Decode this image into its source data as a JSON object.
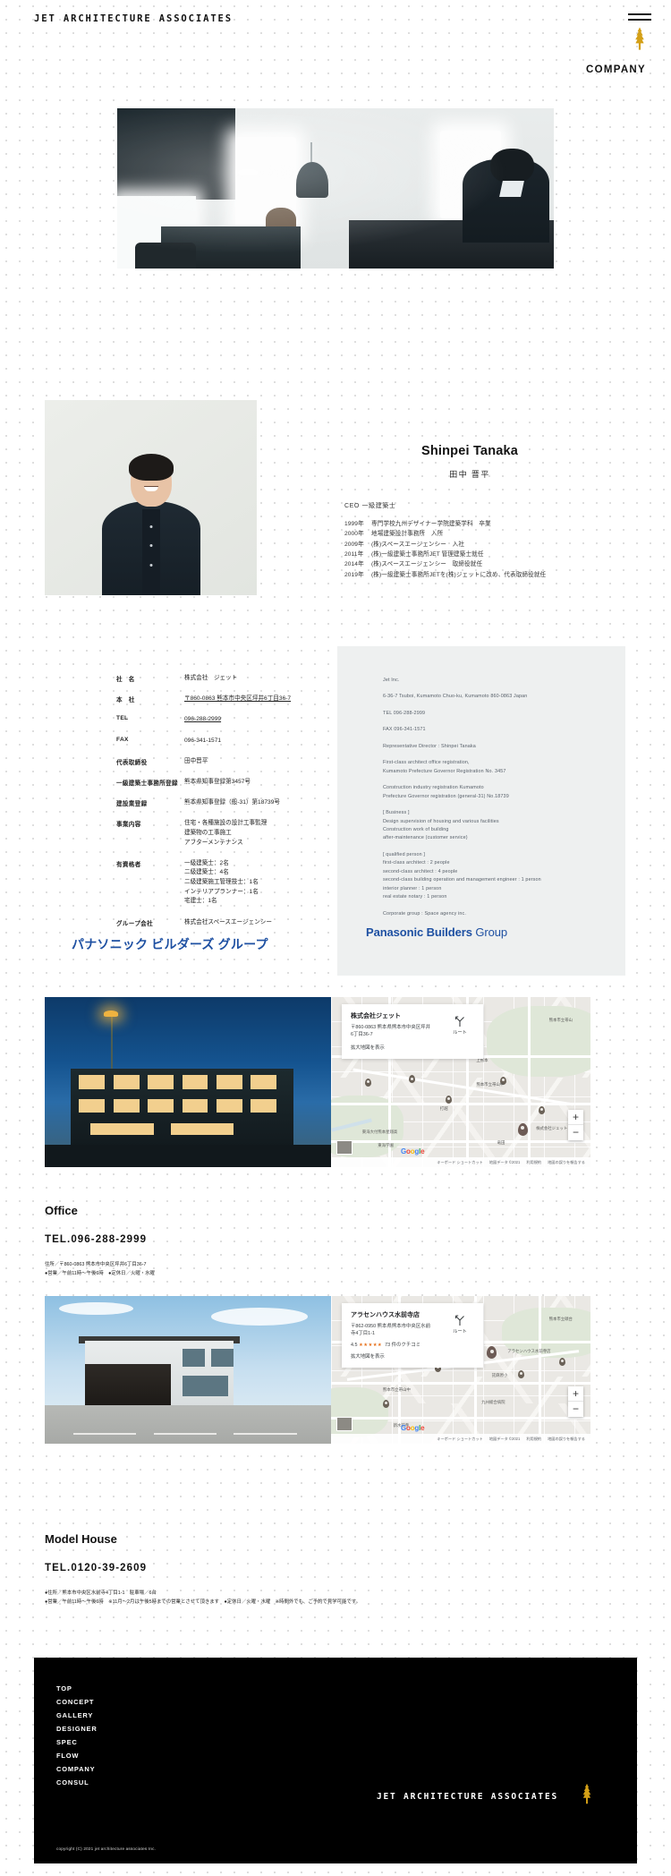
{
  "header": {
    "brand": "JET ARCHITECTURE ASSOCIATES",
    "menu_icon": "hamburger-icon",
    "logo_mark": "tree-icon",
    "page_label": "COMPANY"
  },
  "profile": {
    "name_en": "Shinpei Tanaka",
    "name_ja": "田中 晋平",
    "role": "CEO  一級建築士",
    "history": [
      {
        "year": "1999年",
        "text": "専門学校九州デザイナー学院建築学科　卒業"
      },
      {
        "year": "2000年",
        "text": "地場建築設計事務所　入所"
      },
      {
        "year": "2009年",
        "text": "(株)スペースエージェンシー　入社"
      },
      {
        "year": "2011年",
        "text": "(株)一級建築士事務所JET 管理建築士就任"
      },
      {
        "year": "2014年",
        "text": "(株)スペースエージェンシー　取締役就任"
      },
      {
        "year": "2019年",
        "text": "(株)一級建築士事務所JETを(株)ジェットに改め、代表取締役就任"
      }
    ]
  },
  "company_table": [
    {
      "label": "社　名",
      "values": [
        "株式会社　ジェット"
      ],
      "underline": false
    },
    {
      "label": "本　社",
      "values": [
        "〒860-0863 熊本市中央区坪井6丁目36-7"
      ],
      "underline": true
    },
    {
      "label": "TEL",
      "values": [
        "096-288-2999"
      ],
      "underline": true
    },
    {
      "label": "FAX",
      "values": [
        "096-341-1571"
      ],
      "underline": false
    },
    {
      "label": "代表取締役",
      "values": [
        "田中晋平"
      ],
      "underline": false
    },
    {
      "label": "一級建築士事務所登録",
      "values": [
        "熊本県知事登録第3457号"
      ],
      "underline": false
    },
    {
      "label": "建設業登録",
      "values": [
        "熊本県知事登録（般-31）第18739号"
      ],
      "underline": false
    },
    {
      "label": "事業内容",
      "values": [
        "住宅・各種施設の設計工事監理",
        "建築物の工事施工",
        "アフターメンテナンス"
      ],
      "underline": false
    },
    {
      "label": "有資格者",
      "values": [
        "一級建築士：2名",
        "二級建築士：4名",
        "二級建築施工管理技士：1名",
        "インテリアプランナー：1名",
        "宅建士：1名"
      ],
      "underline": false
    },
    {
      "label": "グループ会社",
      "values": [
        "株式会社スペースエージェンシー"
      ],
      "underline": false
    }
  ],
  "panasonic_left": "パナソニック ビルダーズ グループ",
  "panasonic_right_bold": "Panasonic Builders",
  "panasonic_right_thin": "Group",
  "company_en": [
    "Jet Inc.",
    "6-36-7 Tsuboi, Kumamoto Chuo-ku, Kumamoto 860-0863 Japan",
    "TEL 096-288-2999",
    "FAX 096-341-1571",
    "Representative Director : Shinpei Tanaka",
    "First-class architect office registration,\nKumamoto Prefecture Governor Registration No. 3457",
    "Construction industry registration Kumamoto\nPrefecture Governor registration (general-31) No.18739",
    "[ Business ]\nDesign supervision of housing and various facilities\nConstruction work of building\nafter-maintenance (customer service)",
    "[ qualified person ]\nfirst-class architect : 2 people\nsecond-class architect : 4 people\nsecond-class building operation and management engineer : 1 person\ninterior planner : 1 person\nreal estate notary : 1 person",
    "Corporate group : Space agency inc."
  ],
  "map_office": {
    "card_title": "株式会社ジェット",
    "card_address_line1": "〒860-0863 熊本県熊本市中央区坪井",
    "card_address_line2": "6丁目36-7",
    "card_link": "拡大地図を表示",
    "route_label": "ルート",
    "zoom_in": "+",
    "zoom_out": "−",
    "pin_label": "株式会社ジェット",
    "attribution": [
      "キーボード ショートカット",
      "地図データ ©2021",
      "利用規約",
      "地図の誤りを報告する"
    ],
    "labels": [
      "熊本市立帯山",
      "熊本市立帯山中",
      "打越",
      "東海大付熊本星翔高",
      "東海学園",
      "藤崎宮前",
      "上熊本",
      "竜田"
    ],
    "google": "Google"
  },
  "map_model": {
    "card_title": "アラセンハウス水前寺店",
    "card_address_line1": "〒862-0950 熊本県熊本市中央区水前",
    "card_address_line2": "寺4丁目1-1",
    "card_rating": "4.5",
    "card_stars": "★★★★★",
    "card_reviews": "73 件のクチコミ",
    "card_link": "拡大地図を表示",
    "route_label": "ルート",
    "zoom_in": "+",
    "zoom_out": "−",
    "pin_label": "アラセンハウス水前寺店",
    "attribution": [
      "キーボード ショートカット",
      "地図データ ©2021",
      "利用規約",
      "地図の誤りを報告する"
    ],
    "labels": [
      "中央区",
      "熊本市立帯山中",
      "託麻原小",
      "九州総合病院",
      "水前寺公園",
      "熊本市立碩台",
      "新水前寺"
    ],
    "google": "Google"
  },
  "office": {
    "title": "Office",
    "tel": "TEL.096-288-2999",
    "meta_line1": "住所／〒860-0863 熊本市中央区坪井6丁目36-7",
    "meta_line2": "●営業／午前11時〜午後6時　●定休日／火曜・水曜"
  },
  "model_house": {
    "title": "Model House",
    "tel": "TEL.0120-39-2609",
    "meta_line1": "●住所／熊本市中央区水前寺4丁目1-1　駐車場／6台",
    "meta_line2": "●営業／午前11時〜午後6時　※11月〜2月は午後5時までの営業とさせて頂きます　●定休日／火曜・水曜　※時間外でも、ご予約で見学可能です。"
  },
  "footer": {
    "nav": [
      "TOP",
      "CONCEPT",
      "GALLERY",
      "DESIGNER",
      "SPEC",
      "FLOW",
      "COMPANY",
      "CONSUL"
    ],
    "brand": "JET ARCHITECTURE ASSOCIATES",
    "logo_mark": "tree-icon",
    "copyright": "copyright (C) 2021 jet architecture associates Inc."
  },
  "colors": {
    "accent_gold": "#d4a017",
    "panasonic_blue": "#1e50a2",
    "footer_bg": "#000000",
    "panel_gray": "#eef0f0"
  }
}
